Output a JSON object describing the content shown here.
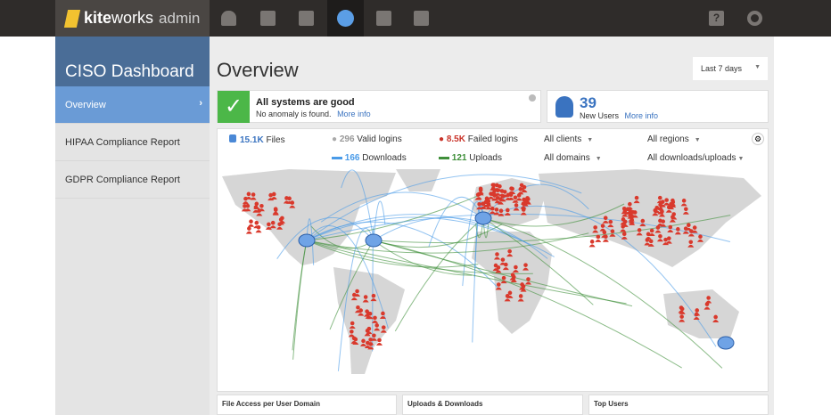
{
  "brand": {
    "name_bold": "kite",
    "name_rest": "works",
    "suffix": "admin"
  },
  "nav": [
    "users-icon",
    "files-icon",
    "reports-icon",
    "globe-icon",
    "devices-icon",
    "integrations-icon"
  ],
  "nav_right": [
    "help-icon",
    "settings-icon"
  ],
  "sidebar": {
    "title": "CISO Dashboard",
    "items": [
      {
        "label": "Overview",
        "active": true
      },
      {
        "label": "HIPAA Compliance Report"
      },
      {
        "label": "GDPR Compliance Report"
      }
    ]
  },
  "main": {
    "title": "Overview",
    "range": "Last 7 days"
  },
  "status": {
    "title": "All systems are good",
    "subtitle": "No anomaly is found.",
    "link": "More info"
  },
  "users": {
    "count": "39",
    "label": "New Users",
    "link": "More info"
  },
  "stats": {
    "files": "15.1K",
    "files_label": "Files",
    "valid": "296",
    "valid_label": "Valid logins",
    "failed": "8.5K",
    "failed_label": "Failed logins",
    "downloads": "166",
    "downloads_label": "Downloads",
    "uploads": "121",
    "uploads_label": "Uploads"
  },
  "filters": {
    "clients": "All clients",
    "regions": "All regions",
    "domains": "All domains",
    "transfers": "All downloads/uploads"
  },
  "bottom": [
    "File Access per User Domain",
    "Uploads & Downloads",
    "Top Users"
  ],
  "colors": {
    "accent": "#3a73c0",
    "failed": "#c9342a",
    "uploads": "#3f8f3a",
    "downloads": "#4a9be8",
    "ok": "#4cb748"
  }
}
